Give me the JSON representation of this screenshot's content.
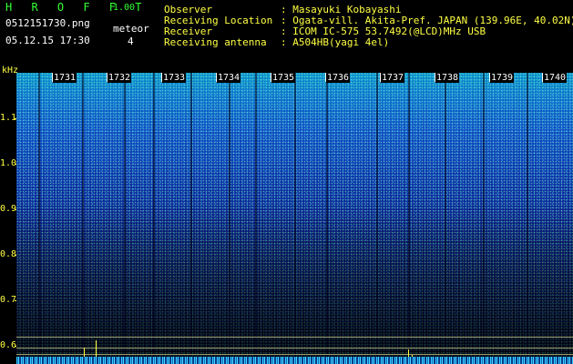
{
  "app": {
    "name": "H R O F F T",
    "version": "1.00"
  },
  "file": {
    "name": "0512151730.png",
    "datetime": "05.12.15 17:30"
  },
  "meteor": {
    "label": "meteor",
    "count": "4"
  },
  "info": [
    {
      "label": "Observer",
      "value": ": Masayuki Kobayashi"
    },
    {
      "label": "Receiving Location",
      "value": ": Ogata-vill. Akita-Pref. JAPAN (139.96E, 40.02N)"
    },
    {
      "label": "Receiver",
      "value": ": ICOM IC-575 53.7492(@LCD)MHz USB"
    },
    {
      "label": "Receiving antenna",
      "value": ": A504HB(yagi 4el)"
    }
  ],
  "axis": {
    "unit": "kHz",
    "ticks": [
      "1.1",
      "1.0",
      "0.9",
      "0.8",
      "0.7",
      "0.6"
    ]
  },
  "minutes": [
    "1731",
    "1732",
    "1733",
    "1734",
    "1735",
    "1736",
    "1737",
    "1738",
    "1739",
    "1740"
  ],
  "colors": {
    "header_green": "#33ff33",
    "axis_yellow": "#ffff44",
    "text_white": "#ffffff"
  }
}
